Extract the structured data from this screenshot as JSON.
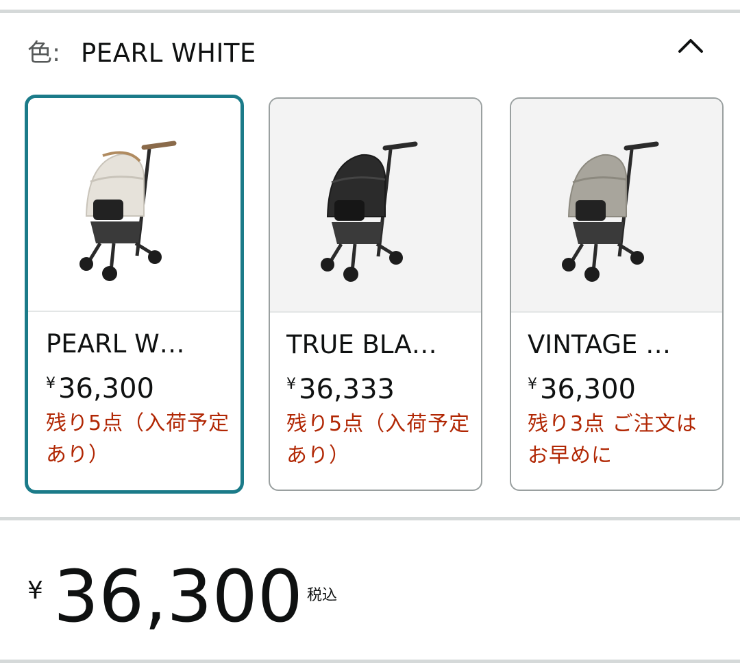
{
  "color_selector": {
    "label": "色:",
    "selected_value": "PEARL WHITE",
    "collapse_icon": "chevron-up-icon"
  },
  "swatches": [
    {
      "name": "PEARL W…",
      "price_currency": "¥",
      "price": "36,300",
      "stock": "残り5点（入荷予定あり）",
      "image": "pet-stroller-pearl-white",
      "body_color": "#e6e2da",
      "selected": true
    },
    {
      "name": "TRUE BLA…",
      "price_currency": "¥",
      "price": "36,333",
      "stock": "残り5点（入荷予定あり）",
      "image": "pet-stroller-true-black",
      "body_color": "#2b2b2b",
      "selected": false
    },
    {
      "name": "VINTAGE …",
      "price_currency": "¥",
      "price": "36,300",
      "stock": "残り3点 ご注文はお早めに",
      "image": "pet-stroller-vintage",
      "body_color": "#a8a59c",
      "selected": false
    }
  ],
  "price_block": {
    "currency": "¥",
    "amount": "36,300",
    "tax_note": "税込"
  },
  "colors": {
    "selected_border": "#1b7b89",
    "stock_text": "#b12704",
    "divider": "#d5d9d9"
  }
}
